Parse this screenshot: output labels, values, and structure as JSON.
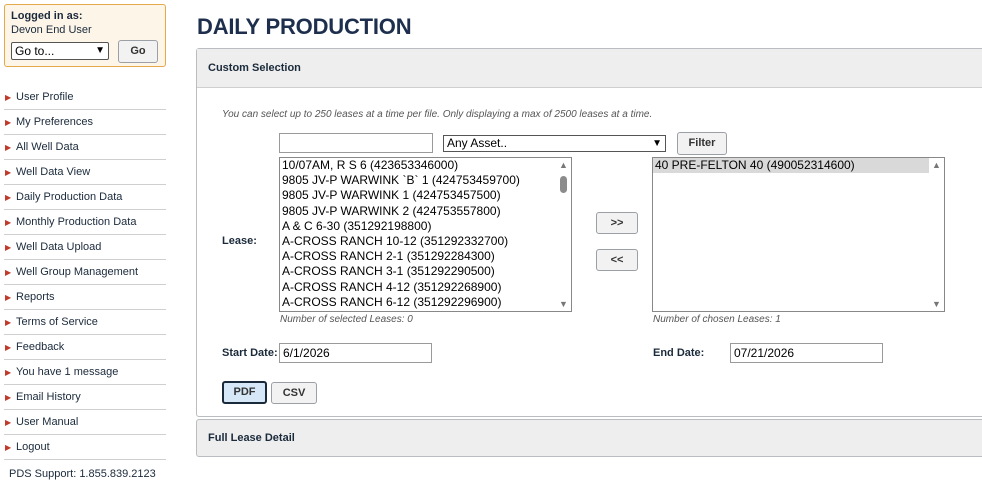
{
  "login": {
    "label": "Logged in as:",
    "user": "Devon End User",
    "goto_value": "Go to...",
    "go_label": "Go"
  },
  "nav": [
    "User Profile",
    "My Preferences",
    "All Well Data",
    "Well Data View",
    "Daily Production Data",
    "Monthly Production Data",
    "Well Data Upload",
    "Well Group Management",
    "Reports",
    "Terms of Service",
    "Feedback",
    "You have 1 message",
    "Email History",
    "User Manual",
    "Logout"
  ],
  "support": "PDS Support: 1.855.839.2123",
  "page": {
    "title": "DAILY PRODUCTION"
  },
  "custom": {
    "header": "Custom Selection",
    "info": "You can select up to 250 leases at a time per file. Only displaying a max of 2500 leases at a time.",
    "search_value": "",
    "asset_value": "Any Asset..",
    "filter_label": "Filter",
    "lease_label": "Lease:",
    "available": [
      "10/07AM, R S 6 (423653346000)",
      "9805 JV-P WARWINK `B` 1 (424753459700)",
      "9805 JV-P WARWINK 1 (424753457500)",
      "9805 JV-P WARWINK 2 (424753557800)",
      "A & C 6-30 (351292198800)",
      "A-CROSS RANCH 10-12 (351292332700)",
      "A-CROSS RANCH 2-1 (351292284300)",
      "A-CROSS RANCH 3-1 (351292290500)",
      "A-CROSS RANCH 4-12 (351292268900)",
      "A-CROSS RANCH 6-12 (351292296900)"
    ],
    "chosen": [
      "40 PRE-FELTON 40 (490052314600)"
    ],
    "add_label": ">>",
    "remove_label": "<<",
    "selected_count": "Number of selected Leases: 0",
    "chosen_count": "Number of chosen Leases: 1",
    "start_label": "Start Date:",
    "start_value": "6/1/2026",
    "end_label": "End Date:",
    "end_value": "07/21/2026",
    "pdf_label": "PDF",
    "csv_label": "CSV"
  },
  "full_detail": {
    "header": "Full Lease Detail"
  },
  "icons": {
    "nav_bullet": "arrow-bullet-icon",
    "select_caret": "chevron-down-icon",
    "scroll_up": "scroll-up-icon",
    "scroll_down": "scroll-down-icon"
  },
  "colors": {
    "login_border": "#e3a94a",
    "login_bg": "#fdf6e8",
    "title": "#1e2f4d",
    "nav_bullet": "#c0392b",
    "selected_row": "#d9d9d9",
    "pdf_active_border": "#1b2a3b",
    "pdf_active_bg": "#d6e8f7"
  }
}
